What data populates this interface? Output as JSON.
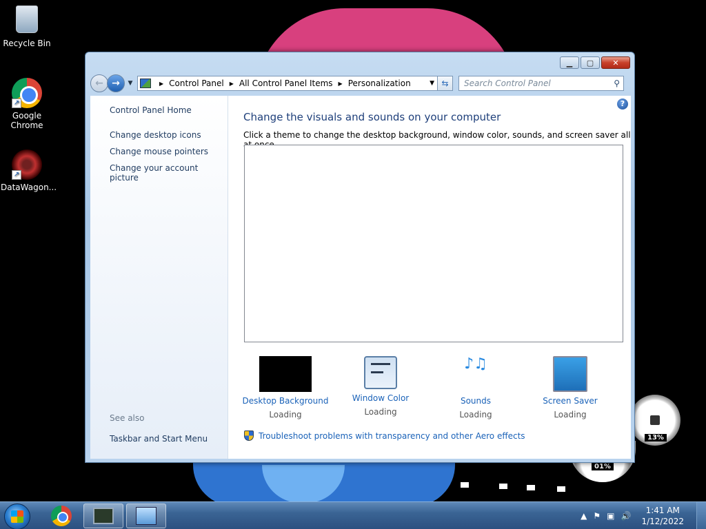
{
  "desktop": {
    "icons": [
      {
        "label": "Recycle Bin"
      },
      {
        "label": "Google Chrome"
      },
      {
        "label": "DataWagon..."
      }
    ]
  },
  "window": {
    "title_buttons": {
      "minimize": "▁",
      "maximize": "▢",
      "close": "✕"
    },
    "address": {
      "crumbs": [
        "Control Panel",
        "All Control Panel Items",
        "Personalization"
      ]
    },
    "search": {
      "placeholder": "Search Control Panel"
    },
    "sidebar": {
      "home": "Control Panel Home",
      "links": [
        "Change desktop icons",
        "Change mouse pointers",
        "Change your account picture"
      ],
      "see_also": "See also",
      "taskbar_link": "Taskbar and Start Menu"
    },
    "main": {
      "heading": "Change the visuals and sounds on your computer",
      "subtitle": "Click a theme to change the desktop background, window color, sounds, and screen saver all at once.",
      "options": [
        {
          "name": "Desktop Background",
          "state": "Loading"
        },
        {
          "name": "Window Color",
          "state": "Loading"
        },
        {
          "name": "Sounds",
          "state": "Loading"
        },
        {
          "name": "Screen Saver",
          "state": "Loading"
        }
      ],
      "troubleshoot": "Troubleshoot problems with transparency and other Aero effects"
    }
  },
  "gadget": {
    "cpu": "13%",
    "mem": "01%"
  },
  "taskbar": {
    "time": "1:41 AM",
    "date": "1/12/2022"
  }
}
